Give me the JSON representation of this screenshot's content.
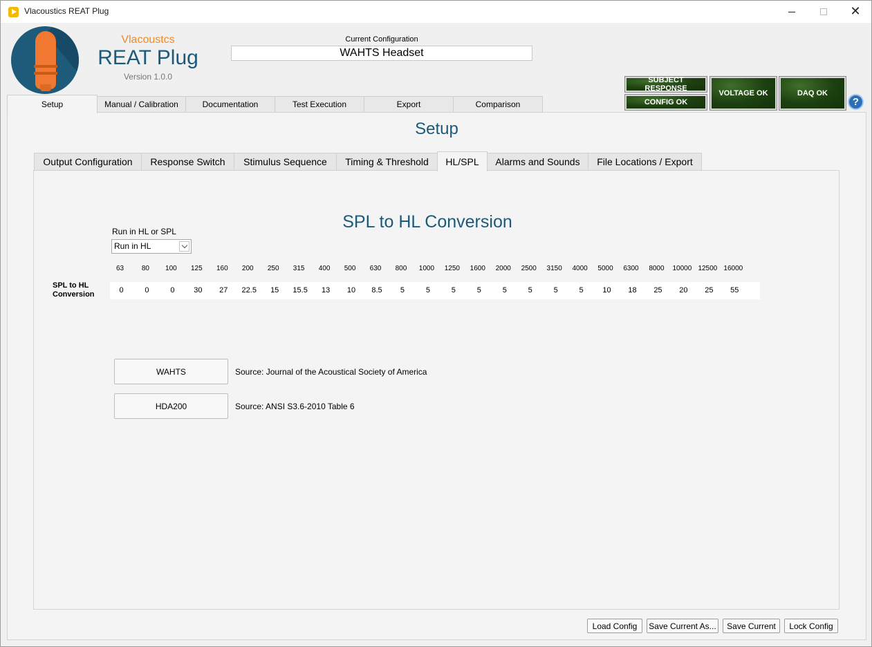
{
  "window": {
    "title": "Vlacoustics REAT Plug"
  },
  "brand": {
    "company": "Vlacoustcs",
    "product": "REAT Plug",
    "version": "Version 1.0.0"
  },
  "current_config": {
    "label": "Current Configuration",
    "value": "WAHTS Headset"
  },
  "status": {
    "subject_response": "SUBJECT RESPONSE",
    "config_ok": "CONFIG OK",
    "voltage_ok": "VOLTAGE OK",
    "daq_ok": "DAQ OK",
    "indicator_color": "#1c3f10"
  },
  "help": {
    "glyph": "?"
  },
  "main_tabs": [
    "Setup",
    "Manual / Calibration",
    "Documentation",
    "Test Execution",
    "Export",
    "Comparison"
  ],
  "active_main_tab": "Setup",
  "page_title": "Setup",
  "sub_tabs": [
    "Output Configuration",
    "Response Switch",
    "Stimulus Sequence",
    "Timing & Threshold",
    "HL/SPL",
    "Alarms and Sounds",
    "File Locations / Export"
  ],
  "active_sub_tab": "HL/SPL",
  "conversion": {
    "title": "SPL to HL Conversion",
    "mode_label": "Run in HL or SPL",
    "mode_value": "Run in HL",
    "row_label_line1": "SPL to HL",
    "row_label_line2": "Conversion",
    "frequencies": [
      "63",
      "80",
      "100",
      "125",
      "160",
      "200",
      "250",
      "315",
      "400",
      "500",
      "630",
      "800",
      "1000",
      "1250",
      "1600",
      "2000",
      "2500",
      "3150",
      "4000",
      "5000",
      "6300",
      "8000",
      "10000",
      "12500",
      "16000"
    ],
    "values": [
      "0",
      "0",
      "0",
      "30",
      "27",
      "22.5",
      "15",
      "15.5",
      "13",
      "10",
      "8.5",
      "5",
      "5",
      "5",
      "5",
      "5",
      "5",
      "5",
      "5",
      "10",
      "18",
      "25",
      "20",
      "25",
      "55"
    ]
  },
  "presets": [
    {
      "button": "WAHTS",
      "source": "Source: Journal of the Acoustical Society of America"
    },
    {
      "button": "HDA200",
      "source": "Source: ANSI S3.6-2010 Table 6"
    }
  ],
  "footer": {
    "load": "Load Config",
    "save_as": "Save Current As...",
    "save": "Save Current",
    "lock": "Lock Config"
  },
  "colors": {
    "accent_blue": "#1d5a7a",
    "accent_orange": "#f08a24"
  }
}
